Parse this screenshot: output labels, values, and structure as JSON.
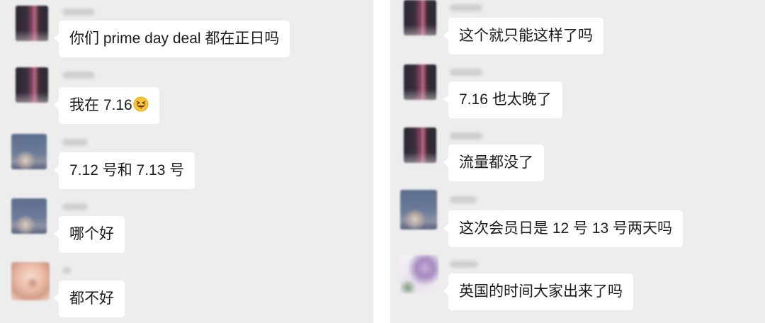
{
  "colors": {
    "chat_background": "#ededed",
    "bubble_background": "#ffffff",
    "divider": "#ffffff",
    "text": "#1b1b1b"
  },
  "panels": [
    {
      "messages": [
        {
          "avatar": "dark",
          "text": "你们 prime day deal 都在正日吗"
        },
        {
          "avatar": "dark",
          "text": "我在 7.16",
          "emoji_icon": "grinning-squinting-face-with-tongue-icon"
        },
        {
          "avatar": "blue",
          "text": "7.12 号和 7.13 号"
        },
        {
          "avatar": "blue",
          "text": "哪个好"
        },
        {
          "avatar": "face",
          "text": "都不好"
        }
      ]
    },
    {
      "messages": [
        {
          "avatar": "dark",
          "text": "这个就只能这样了吗"
        },
        {
          "avatar": "dark",
          "text": "7.16 也太晚了"
        },
        {
          "avatar": "dark",
          "text": "流量都没了"
        },
        {
          "avatar": "blue",
          "text": "这次会员日是 12 号 13 号两天吗"
        },
        {
          "avatar": "light",
          "text": "英国的时间大家出来了吗"
        }
      ]
    }
  ]
}
